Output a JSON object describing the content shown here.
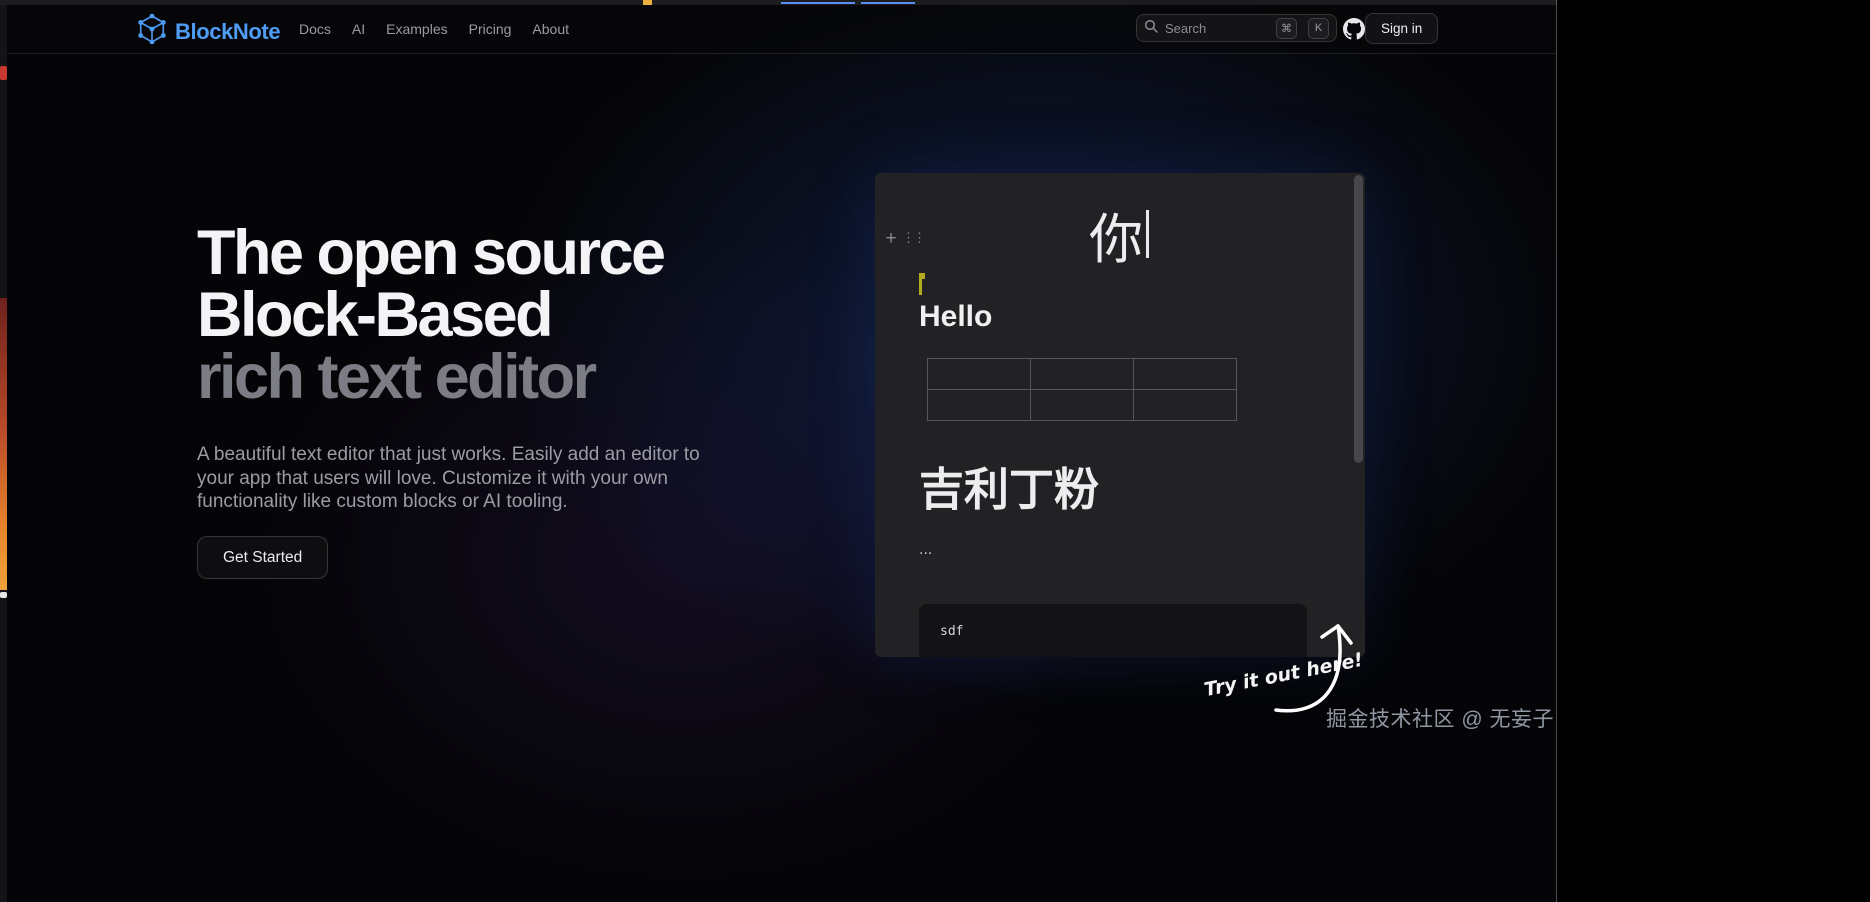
{
  "header": {
    "logo_text": "BlockNote",
    "nav": [
      {
        "label": "Docs"
      },
      {
        "label": "AI"
      },
      {
        "label": "Examples"
      },
      {
        "label": "Pricing"
      },
      {
        "label": "About"
      }
    ],
    "search": {
      "placeholder": "Search",
      "shortcut_mod": "⌘",
      "shortcut_key": "K"
    },
    "sign_in_label": "Sign in"
  },
  "hero": {
    "title_lines": [
      "The open source",
      "Block-Based",
      "rich text editor"
    ],
    "description": "A beautiful text editor that just works. Easily add an editor to your app that users will love. Customize it with your own functionality like custom blocks or AI tooling.",
    "cta_label": "Get Started"
  },
  "editor_demo": {
    "typed_char": "你",
    "heading": "Hello",
    "table": {
      "rows": 2,
      "cols": 3
    },
    "subheading": "吉利丁粉",
    "ellipsis": "...",
    "code_text": "sdf"
  },
  "annotation": {
    "label": "Try it out here!"
  },
  "watermark_text": "掘金技术社区 @ 无妄子",
  "icons": {
    "plus_icon": "+",
    "drag_handle_icon": "⋮⋮"
  },
  "colors": {
    "accent_blue": "#4f9cf6",
    "background": "#050507",
    "panel": "#222224",
    "collab_cursor_yellow": "#b3ab1e",
    "glow_blue": "#213f8e"
  }
}
